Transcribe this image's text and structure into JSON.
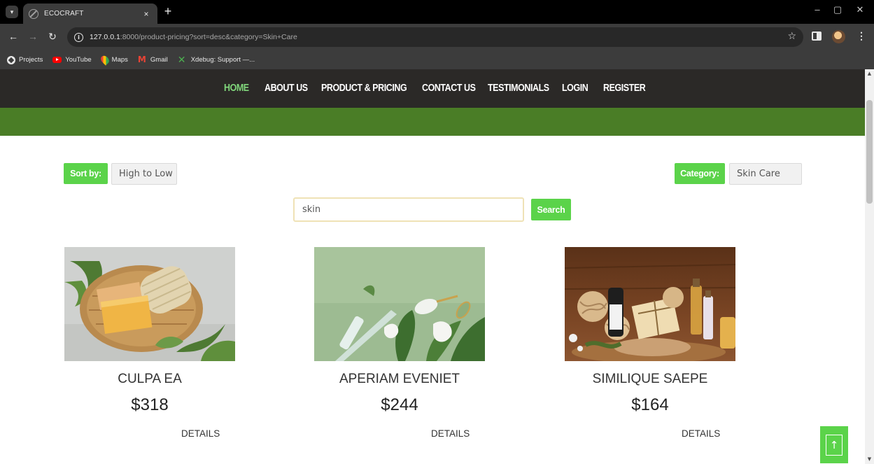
{
  "browser": {
    "tab_title": "ECOCRAFT",
    "tab_close": "×",
    "new_tab": "+",
    "url_host": "127.0.0.1",
    "url_rest": ":8000/product-pricing?sort=desc&category=Skin+Care",
    "bookmarks": [
      {
        "label": "Projects",
        "icon": "projects-icon"
      },
      {
        "label": "YouTube",
        "icon": "youtube-icon"
      },
      {
        "label": "Maps",
        "icon": "maps-icon"
      },
      {
        "label": "Gmail",
        "icon": "gmail-icon"
      },
      {
        "label": "Xdebug: Support —...",
        "icon": "xdebug-icon"
      }
    ]
  },
  "nav": {
    "items": [
      {
        "label": "HOME",
        "active": true
      },
      {
        "label": "ABOUT US"
      },
      {
        "label": "PRODUCT & PRICING"
      },
      {
        "label": "CONTACT US"
      },
      {
        "label": "TESTIMONIALS"
      },
      {
        "label": "LOGIN"
      },
      {
        "label": "REGISTER"
      }
    ]
  },
  "filters": {
    "sort_label": "Sort by:",
    "sort_value": "High to Low",
    "category_label": "Category:",
    "category_value": "Skin Care"
  },
  "search": {
    "value": "skin",
    "button_label": "Search"
  },
  "products": [
    {
      "name": "CULPA EA",
      "price": "$318",
      "details_label": "DETAILS"
    },
    {
      "name": "APERIAM EVENIET",
      "price": "$244",
      "details_label": "DETAILS"
    },
    {
      "name": "SIMILIQUE SAEPE",
      "price": "$164",
      "details_label": "DETAILS"
    }
  ],
  "colors": {
    "accent_green": "#5bd34a",
    "nav_bg": "#2b2927",
    "band_green": "#4a7d26",
    "nav_active": "#80d67b"
  }
}
